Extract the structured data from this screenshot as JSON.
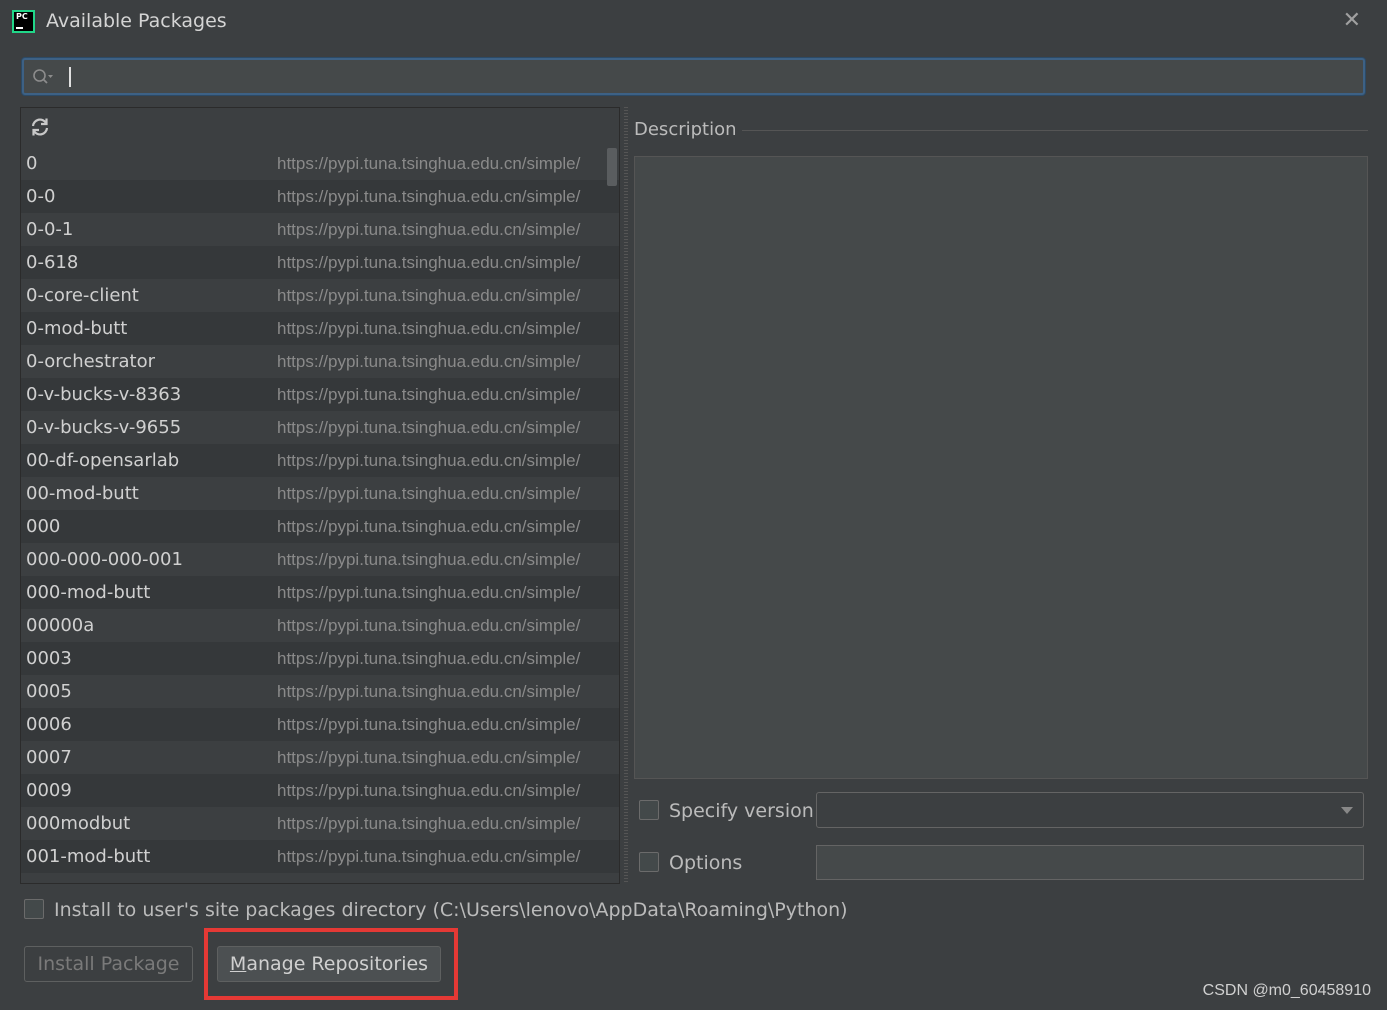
{
  "window": {
    "title": "Available Packages",
    "close_symbol": "✕",
    "app_icon_text": "PC"
  },
  "search": {
    "value": ""
  },
  "packages": [
    {
      "name": "0",
      "repo": "https://pypi.tuna.tsinghua.edu.cn/simple/"
    },
    {
      "name": "0-0",
      "repo": "https://pypi.tuna.tsinghua.edu.cn/simple/"
    },
    {
      "name": "0-0-1",
      "repo": "https://pypi.tuna.tsinghua.edu.cn/simple/"
    },
    {
      "name": "0-618",
      "repo": "https://pypi.tuna.tsinghua.edu.cn/simple/"
    },
    {
      "name": "0-core-client",
      "repo": "https://pypi.tuna.tsinghua.edu.cn/simple/"
    },
    {
      "name": "0-mod-butt",
      "repo": "https://pypi.tuna.tsinghua.edu.cn/simple/"
    },
    {
      "name": "0-orchestrator",
      "repo": "https://pypi.tuna.tsinghua.edu.cn/simple/"
    },
    {
      "name": "0-v-bucks-v-8363",
      "repo": "https://pypi.tuna.tsinghua.edu.cn/simple/"
    },
    {
      "name": "0-v-bucks-v-9655",
      "repo": "https://pypi.tuna.tsinghua.edu.cn/simple/"
    },
    {
      "name": "00-df-opensarlab",
      "repo": "https://pypi.tuna.tsinghua.edu.cn/simple/"
    },
    {
      "name": "00-mod-butt",
      "repo": "https://pypi.tuna.tsinghua.edu.cn/simple/"
    },
    {
      "name": "000",
      "repo": "https://pypi.tuna.tsinghua.edu.cn/simple/"
    },
    {
      "name": "000-000-000-001",
      "repo": "https://pypi.tuna.tsinghua.edu.cn/simple/"
    },
    {
      "name": "000-mod-butt",
      "repo": "https://pypi.tuna.tsinghua.edu.cn/simple/"
    },
    {
      "name": "00000a",
      "repo": "https://pypi.tuna.tsinghua.edu.cn/simple/"
    },
    {
      "name": "0003",
      "repo": "https://pypi.tuna.tsinghua.edu.cn/simple/"
    },
    {
      "name": "0005",
      "repo": "https://pypi.tuna.tsinghua.edu.cn/simple/"
    },
    {
      "name": "0006",
      "repo": "https://pypi.tuna.tsinghua.edu.cn/simple/"
    },
    {
      "name": "0007",
      "repo": "https://pypi.tuna.tsinghua.edu.cn/simple/"
    },
    {
      "name": "0009",
      "repo": "https://pypi.tuna.tsinghua.edu.cn/simple/"
    },
    {
      "name": "000modbut",
      "repo": "https://pypi.tuna.tsinghua.edu.cn/simple/"
    },
    {
      "name": "001-mod-butt",
      "repo": "https://pypi.tuna.tsinghua.edu.cn/simple/"
    }
  ],
  "description": {
    "label": "Description"
  },
  "options": {
    "specify_version_label": "Specify version",
    "options_label": "Options",
    "install_user_site_label": "Install to user's site packages directory (C:\\Users\\lenovo\\AppData\\Roaming\\Python)"
  },
  "buttons": {
    "install_package": "Install Package",
    "manage_repositories_mnemonic": "M",
    "manage_repositories_rest": "anage Repositories"
  },
  "watermark": "CSDN @m0_60458910",
  "icons": {
    "app": "pycharm-icon",
    "close": "close-icon",
    "search": "search-icon",
    "refresh": "refresh-icon",
    "dropdown": "chevron-down-icon"
  },
  "colors": {
    "background": "#3c3f41",
    "search_border": "#3d6185",
    "highlight_box": "#e53935"
  }
}
